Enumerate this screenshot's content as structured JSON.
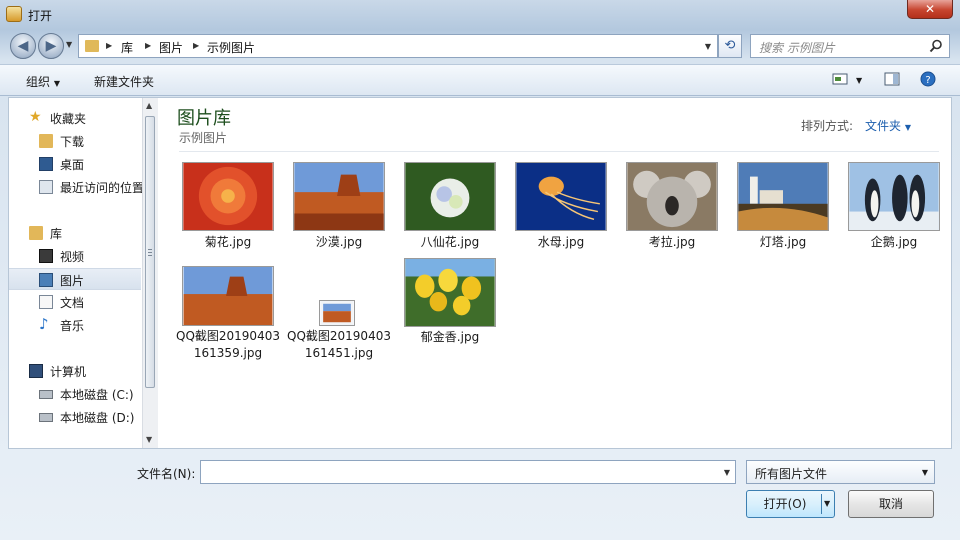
{
  "window": {
    "title": "打开",
    "close_label": "✕"
  },
  "nav": {
    "breadcrumbs": [
      "库",
      "图片",
      "示例图片"
    ],
    "search_placeholder": "搜索 示例图片"
  },
  "toolbar": {
    "organize": "组织",
    "new_folder": "新建文件夹"
  },
  "sidebar": {
    "favorites": "收藏夹",
    "downloads": "下载",
    "desktop": "桌面",
    "recent": "最近访问的位置",
    "libraries": "库",
    "videos": "视频",
    "pictures": "图片",
    "documents": "文档",
    "music": "音乐",
    "computer": "计算机",
    "drive_c": "本地磁盘 (C:)",
    "drive_d": "本地磁盘 (D:)"
  },
  "main": {
    "library_title": "图片库",
    "library_subtitle": "示例图片",
    "sort_label": "排列方式:",
    "sort_value": "文件夹"
  },
  "files": [
    {
      "name": "菊花.jpg"
    },
    {
      "name": "沙漠.jpg"
    },
    {
      "name": "八仙花.jpg"
    },
    {
      "name": "水母.jpg"
    },
    {
      "name": "考拉.jpg"
    },
    {
      "name": "灯塔.jpg"
    },
    {
      "name": "企鹅.jpg"
    },
    {
      "name": "QQ截图20190403161359.jpg"
    },
    {
      "name": "QQ截图20190403161451.jpg"
    },
    {
      "name": "郁金香.jpg"
    }
  ],
  "footer": {
    "filename_label": "文件名(N):",
    "filename_value": "",
    "filter_value": "所有图片文件",
    "open_button": "打开(O)",
    "cancel_button": "取消"
  }
}
